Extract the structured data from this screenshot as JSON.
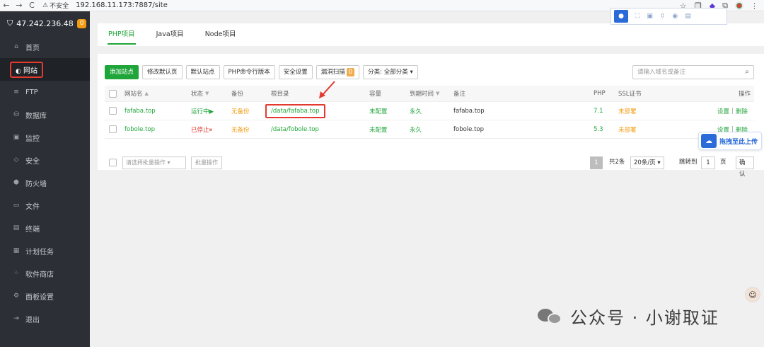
{
  "browser": {
    "back": "←",
    "forward": "→",
    "reload": "C",
    "insecure_label": "不安全",
    "url": "192.168.11.173:7887/site"
  },
  "sidebar": {
    "server_ip": "47.242.236.48",
    "badge": "0",
    "items": [
      {
        "label": "首页",
        "icon": "home-icon"
      },
      {
        "label": "网站",
        "icon": "globe-icon"
      },
      {
        "label": "FTP",
        "icon": "ftp-icon"
      },
      {
        "label": "数据库",
        "icon": "database-icon"
      },
      {
        "label": "监控",
        "icon": "monitor-icon"
      },
      {
        "label": "安全",
        "icon": "shield-icon"
      },
      {
        "label": "防火墙",
        "icon": "firewall-icon"
      },
      {
        "label": "文件",
        "icon": "folder-icon"
      },
      {
        "label": "终端",
        "icon": "terminal-icon"
      },
      {
        "label": "计划任务",
        "icon": "calendar-icon"
      },
      {
        "label": "软件商店",
        "icon": "grid-icon"
      },
      {
        "label": "面板设置",
        "icon": "gear-icon"
      },
      {
        "label": "退出",
        "icon": "logout-icon"
      }
    ]
  },
  "tabs": [
    "PHP项目",
    "Java项目",
    "Node项目"
  ],
  "toolbar": {
    "add_site": "添加站点",
    "modify_default_page": "修改默认页",
    "default_site": "默认站点",
    "php_cli": "PHP命令行版本",
    "security": "安全设置",
    "vuln_scan": "漏洞扫描",
    "vuln_count": "0",
    "category": "分类: 全部分类"
  },
  "search": {
    "placeholder": "请输入域名或备注"
  },
  "table": {
    "headers": {
      "name": "网站名",
      "status": "状态",
      "backup": "备份",
      "root": "根目录",
      "capacity": "容量",
      "expire": "到期时间",
      "remark": "备注",
      "php": "PHP",
      "ssl": "SSL证书",
      "action": "操作"
    },
    "rows": [
      {
        "name": "fafaba.top",
        "status": "运行中▶",
        "backup": "无备份",
        "root": "/data/fafaba.top",
        "capacity": "未配置",
        "expire": "永久",
        "remark": "fafaba.top",
        "php": "7.1",
        "ssl": "未部署",
        "set": "设置",
        "sep": "|",
        "del": "删除"
      },
      {
        "name": "fobole.top",
        "status": "已停止⏸",
        "backup": "无备份",
        "root": "/data/fobole.top",
        "capacity": "未配置",
        "expire": "永久",
        "remark": "fobole.top",
        "php": "5.3",
        "ssl": "未部署",
        "set": "设置",
        "sep": "|",
        "del": "删除"
      }
    ]
  },
  "footer": {
    "batch_placeholder": "请选择批量操作",
    "batch_button": "批量操作",
    "page": "1",
    "total": "共2条",
    "per_page": "20条/页",
    "jump_label": "跳转到",
    "jump_value": "1",
    "page_unit": "页",
    "confirm": "确认"
  },
  "float_toolbar": {
    "camera": "■"
  },
  "upload_widget": {
    "label": "拖拽至此上传"
  },
  "watermark": {
    "text": "公众号 · 小谢取证"
  }
}
